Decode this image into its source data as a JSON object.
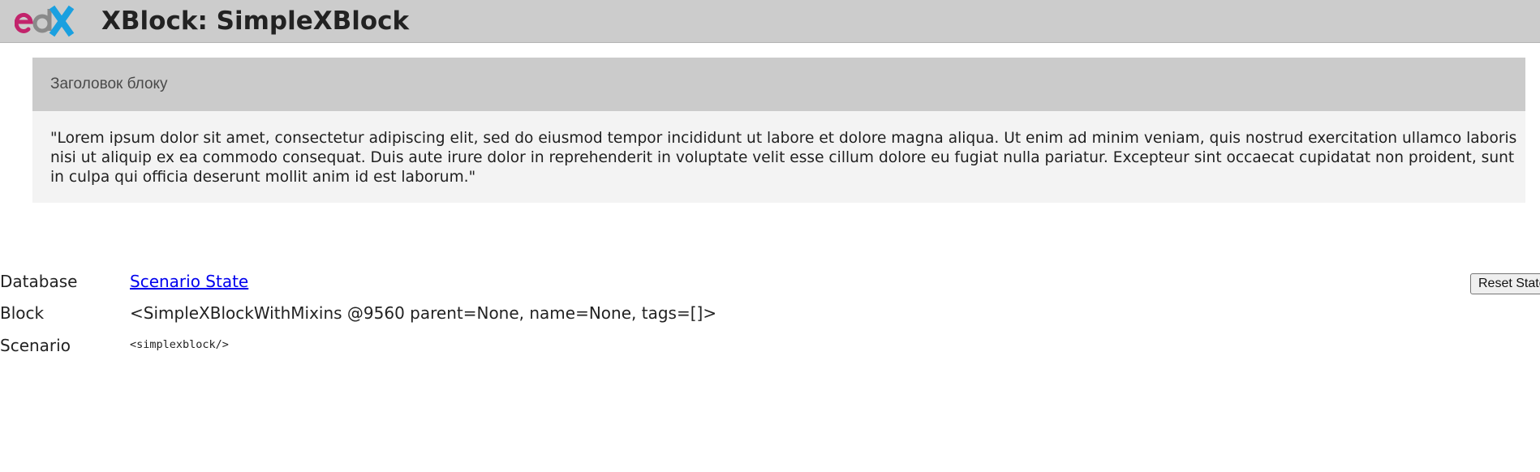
{
  "header": {
    "logo": "edX",
    "title": "XBlock: SimpleXBlock"
  },
  "block": {
    "header_title": "Заголовок блоку",
    "body_text": "\"Lorem ipsum dolor sit amet, consectetur adipiscing elit, sed do eiusmod tempor incididunt ut labore et dolore magna aliqua. Ut enim ad minim veniam, quis nostrud exercitation ullamco laboris nisi ut aliquip ex ea commodo consequat. Duis aute irure dolor in reprehenderit in voluptate velit esse cillum dolore eu fugiat nulla pariatur. Excepteur sint occaecat cupidatat non proident, sunt in culpa qui officia deserunt mollit anim id est laborum.\""
  },
  "info": {
    "database_label": "Database",
    "database_link": "Scenario State",
    "block_label": "Block",
    "block_value": "<SimpleXBlockWithMixins @9560 parent=None, name=None, tags=[]>",
    "scenario_label": "Scenario",
    "scenario_value": "<simplexblock/>"
  },
  "actions": {
    "reset_label": "Reset State"
  },
  "colors": {
    "logo_magenta": "#c2246c",
    "logo_gray": "#8a8a8a",
    "logo_blue": "#1aa0e0",
    "link": "#0000ee"
  }
}
